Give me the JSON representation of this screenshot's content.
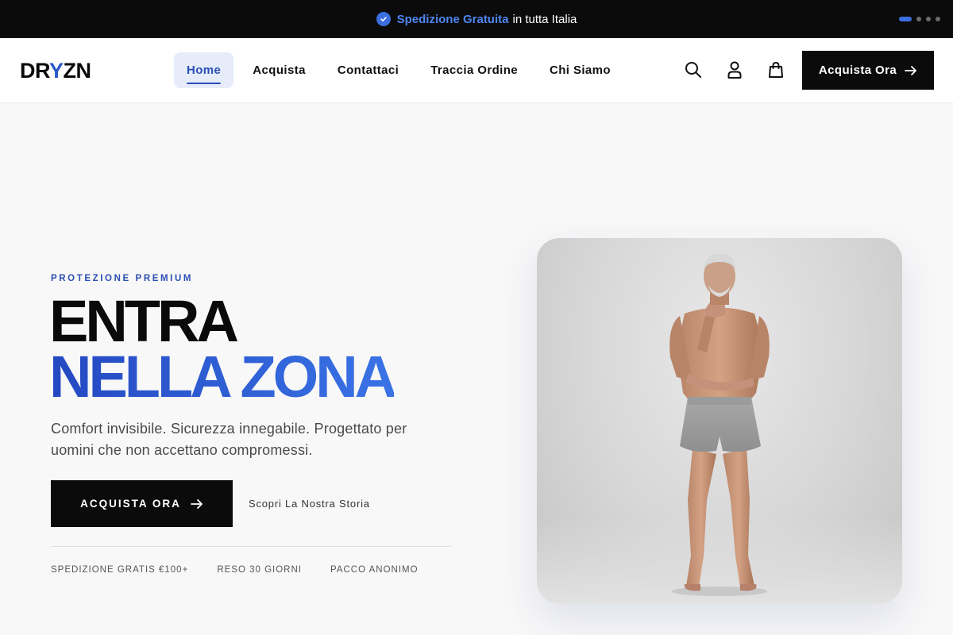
{
  "announcement": {
    "highlight": "Spedizione Gratuita",
    "text": "in tutta Italia",
    "slides": 4,
    "active_slide": 1
  },
  "header": {
    "logo_text_pre": "DR",
    "logo_text_accent": "Y",
    "logo_text_post": "ZN",
    "nav": [
      {
        "label": "Home",
        "active": true
      },
      {
        "label": "Acquista"
      },
      {
        "label": "Contattaci"
      },
      {
        "label": "Traccia Ordine"
      },
      {
        "label": "Chi Siamo"
      }
    ],
    "icons": [
      "search-icon",
      "account-icon",
      "bag-icon"
    ],
    "cta_label": "Acquista Ora"
  },
  "hero": {
    "eyebrow": "PROTEZIONE PREMIUM",
    "title_line1": "ENTRA",
    "title_line2": "NELLA ZONA",
    "subtitle": "Comfort invisibile. Sicurezza innegabile. Progettato per uomini che non accettano compromessi.",
    "cta_label": "ACQUISTA ORA",
    "secondary_link": "Scopri La Nostra Storia",
    "perks": [
      "SPEDIZIONE GRATIS €100+",
      "RESO 30 GIORNI",
      "PACCO ANONIMO"
    ]
  },
  "colors": {
    "accent": "#2a4fb3",
    "accent_light": "#3b6fe0",
    "dark": "#0b0b0b"
  }
}
